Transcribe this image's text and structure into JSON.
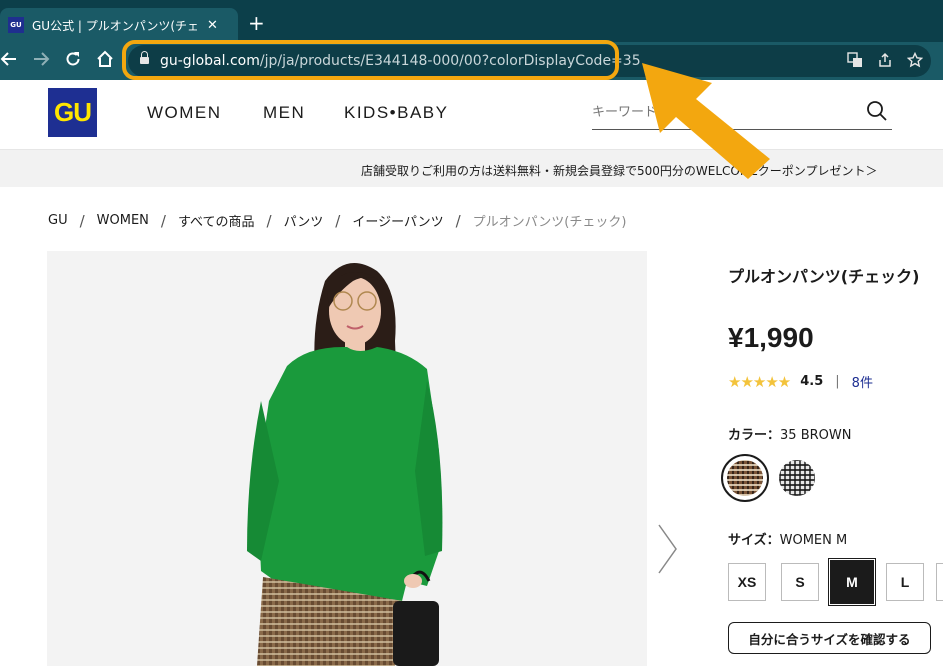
{
  "browser": {
    "tab_favicon": "GU",
    "tab_title": "GU公式 | プルオンパンツ(チェック) | フ",
    "new_tab": "+",
    "url_host": "gu-global.com",
    "url_path": "/jp/ja/products/E344148-000/00?colorDisplayCode=35",
    "highlight_color": "#f3a70f"
  },
  "header": {
    "logo": "GU",
    "nav": [
      "WOMEN",
      "MEN",
      "KIDS•BABY"
    ],
    "search_placeholder": "キーワード"
  },
  "promo": "店舗受取りご利用の方は送料無料・新規会員登録で500円分のWELCOMEクーポンプレゼント＞",
  "breadcrumb": [
    "GU",
    "WOMEN",
    "すべての商品",
    "パンツ",
    "イージーパンツ",
    "プルオンパンツ(チェック)"
  ],
  "product": {
    "name": "プルオンパンツ(チェック)",
    "price": "¥1,990",
    "stars": "★★★★★",
    "rating": "4.5",
    "divider": "|",
    "review_count": "8件",
    "color_label": "カラー：",
    "color_value": "35 BROWN",
    "size_label": "サイズ：",
    "size_value": "WOMEN M",
    "sizes": [
      "XS",
      "S",
      "M",
      "L"
    ],
    "fit_button": "自分に合うサイズを確認する"
  }
}
